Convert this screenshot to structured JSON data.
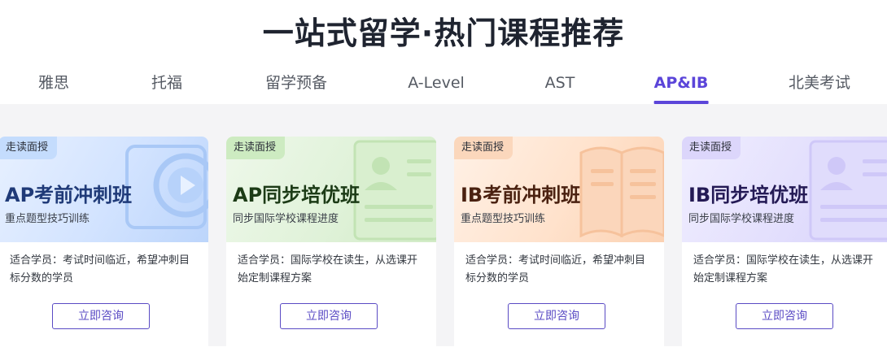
{
  "page_title": "一站式留学·热门课程推荐",
  "tabs": [
    {
      "label": "雅思"
    },
    {
      "label": "托福"
    },
    {
      "label": "留学预备"
    },
    {
      "label": "A-Level"
    },
    {
      "label": "AST"
    },
    {
      "label": "AP&IB",
      "active": true
    },
    {
      "label": "北美考试"
    }
  ],
  "cards": [
    {
      "badge": "走读面授",
      "title": "AP考前冲刺班",
      "subtitle": "重点题型技巧训练",
      "description": "适合学员：考试时间临近，希望冲刺目标分数的学员",
      "button": "立即咨询",
      "theme_color": "#1f3a78",
      "icon": "video-play-icon"
    },
    {
      "badge": "走读面授",
      "title": "AP同步培优班",
      "subtitle": "同步国际学校课程进度",
      "description": "适合学员：国际学校在读生，从选课开始定制课程方案",
      "button": "立即咨询",
      "theme_color": "#1c3b16",
      "icon": "person-board-icon"
    },
    {
      "badge": "走读面授",
      "title": "IB考前冲刺班",
      "subtitle": "重点题型技巧训练",
      "description": "适合学员：考试时间临近，希望冲刺目标分数的学员",
      "button": "立即咨询",
      "theme_color": "#4a2110",
      "icon": "open-book-icon"
    },
    {
      "badge": "走读面授",
      "title": "IB同步培优班",
      "subtitle": "同步国际学校课程进度",
      "description": "适合学员：国际学校在读生，从选课开始定制课程方案",
      "button": "立即咨询",
      "theme_color": "#241a55",
      "icon": "person-board-icon"
    }
  ],
  "colors": {
    "accent": "#5b45d9",
    "button_border": "#5a4bc4",
    "title": "#1f2430"
  }
}
